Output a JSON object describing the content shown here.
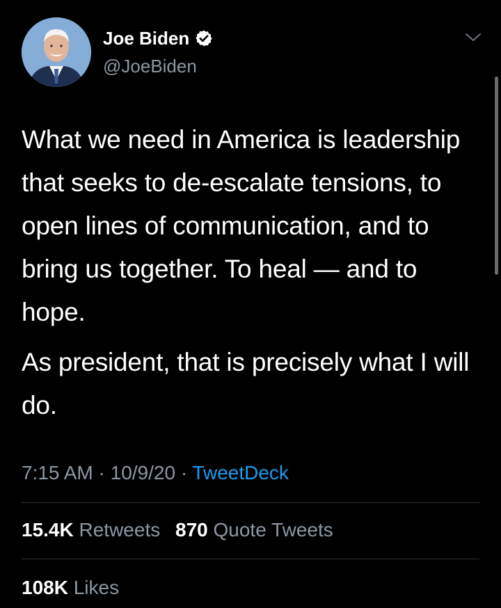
{
  "colors": {
    "background": "#000000",
    "primary_text": "#ffffff",
    "secondary_text": "#8b98a5",
    "link": "#1d9bf0",
    "divider": "#2f3336"
  },
  "author": {
    "display_name": "Joe Biden",
    "handle": "@JoeBiden",
    "verified": true,
    "avatar_icon": "profile-photo"
  },
  "tweet": {
    "paragraphs": [
      "What we need in America is leadership that seeks to de-escalate tensions, to open lines of communication, and to bring us together. To heal — and to hope.",
      "As president, that is precisely what I will do."
    ]
  },
  "meta": {
    "time": "7:15 AM",
    "separator": " · ",
    "date": "10/9/20",
    "source": "TweetDeck"
  },
  "stats": {
    "retweets_count": "15.4K",
    "retweets_label": "Retweets",
    "quote_tweets_count": "870",
    "quote_tweets_label": "Quote Tweets",
    "likes_count": "108K",
    "likes_label": "Likes"
  }
}
